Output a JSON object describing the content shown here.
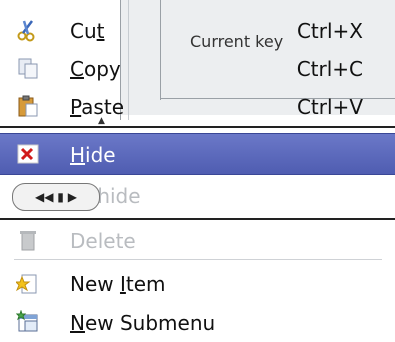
{
  "background": {
    "current_key_label": "Current key"
  },
  "menu": {
    "items": [
      {
        "label_pre": "Cu",
        "accel": "t",
        "label_post": "",
        "shortcut": "Ctrl+X",
        "icon": "scissors-icon",
        "state": "normal"
      },
      {
        "label_pre": "",
        "accel": "C",
        "label_post": "opy",
        "shortcut": "Ctrl+C",
        "icon": "copy-icon",
        "state": "normal"
      },
      {
        "label_pre": "",
        "accel": "P",
        "label_post": "aste",
        "shortcut": "Ctrl+V",
        "icon": "paste-icon",
        "state": "normal"
      },
      {
        "label_pre": "",
        "accel": "H",
        "label_post": "ide",
        "shortcut": "",
        "icon": "hide-icon",
        "state": "selected"
      },
      {
        "label_pre": "",
        "accel": "U",
        "label_post": "nhide",
        "shortcut": "",
        "icon": "unhide-icon",
        "state": "disabled"
      },
      {
        "label_pre": "",
        "accel": "",
        "label_post": "Delete",
        "shortcut": "",
        "icon": "trash-icon",
        "state": "disabled"
      },
      {
        "label_pre": "New ",
        "accel": "I",
        "label_post": "tem",
        "shortcut": "",
        "icon": "new-item-icon",
        "state": "normal"
      },
      {
        "label_pre": "",
        "accel": "N",
        "label_post": "ew Submenu",
        "shortcut": "",
        "icon": "new-submenu-icon",
        "state": "normal"
      }
    ],
    "widget_glyph": "◀◀ ▮ ▶"
  },
  "colors": {
    "selection": "#5563b8",
    "disabled_text": "#b9bcc0"
  }
}
